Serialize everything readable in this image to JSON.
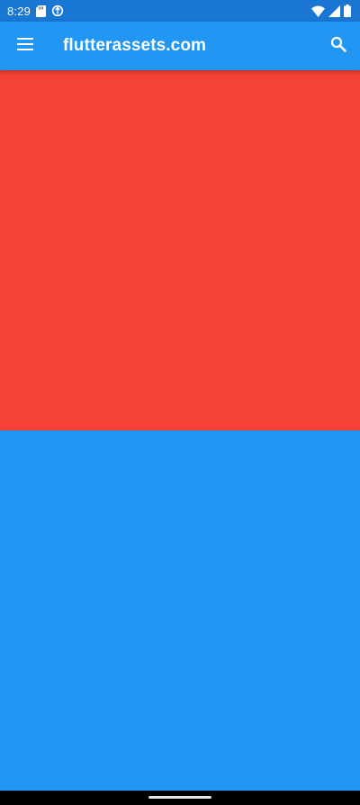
{
  "status_bar": {
    "time": "8:29",
    "left_icons": [
      "sd-card-icon",
      "data-saver-icon"
    ],
    "right_icons": [
      "wifi-icon",
      "cell-signal-icon",
      "battery-icon"
    ],
    "color": "#1976D2"
  },
  "app_bar": {
    "title": "flutterassets.com",
    "leading_icon": "menu-icon",
    "action_icon": "search-icon",
    "color": "#2196F3"
  },
  "body": {
    "blocks": [
      {
        "name": "red-block",
        "color": "#F44336"
      },
      {
        "name": "blue-block",
        "color": "#2196F3"
      }
    ]
  },
  "navigation_bar": {
    "handle": "home-gesture-handle"
  }
}
